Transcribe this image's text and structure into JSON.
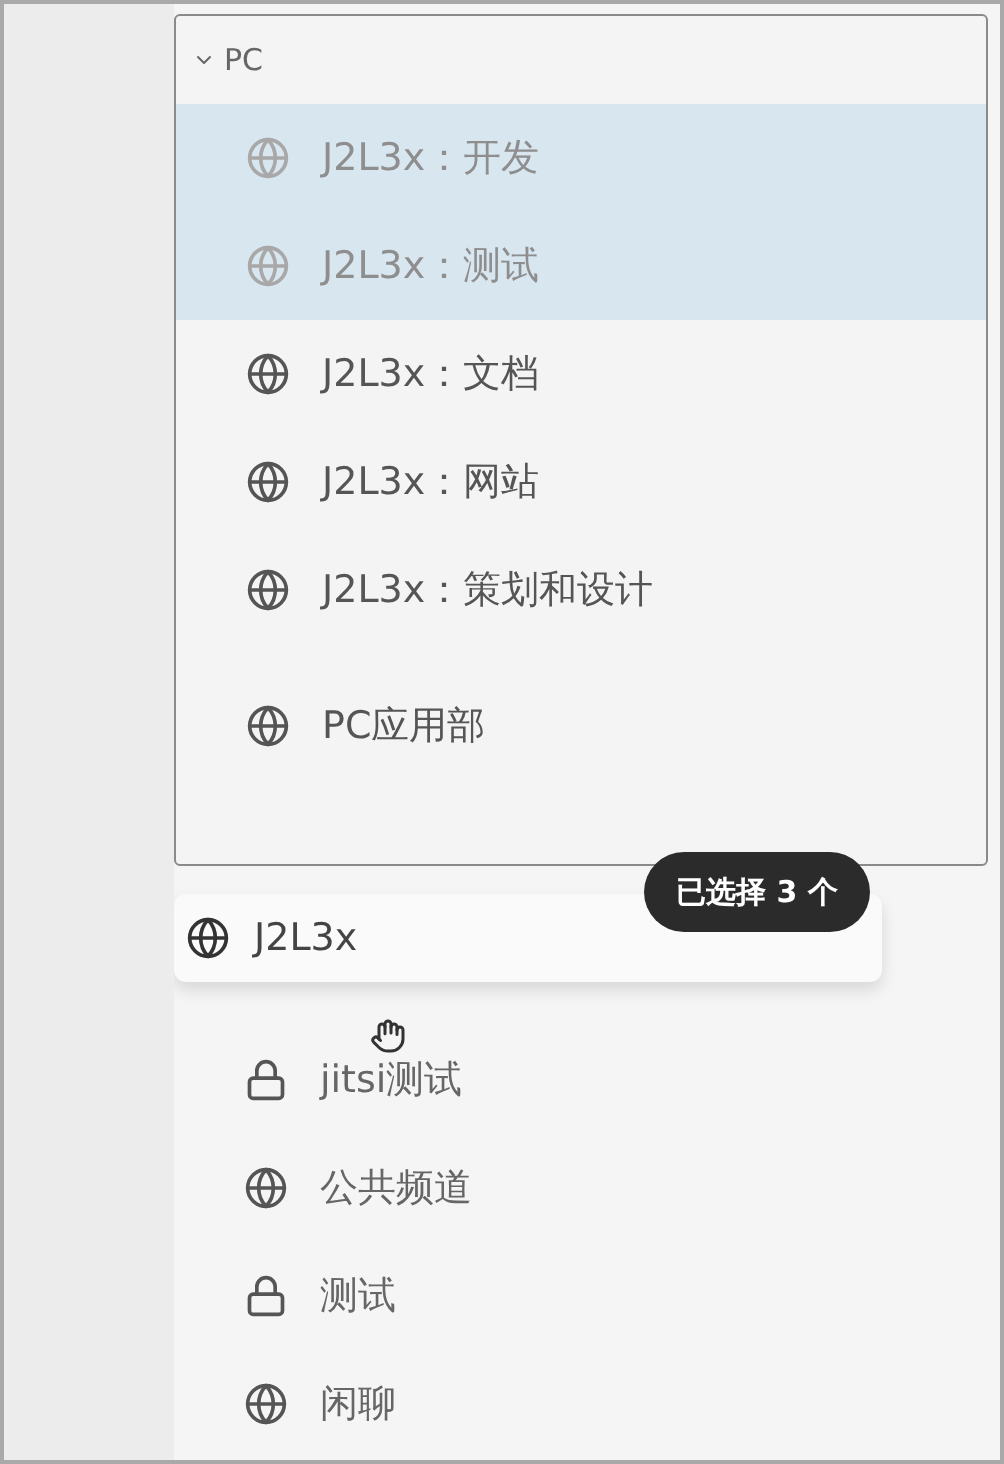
{
  "dropdown": {
    "section": {
      "label": "PC",
      "expanded": true
    },
    "items": [
      {
        "label": "J2L3x：开发",
        "kind": "globe",
        "selected": true
      },
      {
        "label": "J2L3x：测试",
        "kind": "globe",
        "selected": true
      },
      {
        "label": "J2L3x：文档",
        "kind": "globe",
        "selected": false
      },
      {
        "label": "J2L3x：网站",
        "kind": "globe",
        "selected": false
      },
      {
        "label": "J2L3x：策划和设计",
        "kind": "globe",
        "selected": false
      },
      {
        "label": "PC应用部",
        "kind": "globe",
        "selected": false
      }
    ]
  },
  "drag_item": {
    "label": "J2L3x",
    "kind": "globe"
  },
  "badge": "已选择 3 个",
  "channels": [
    {
      "label": "jitsi测试",
      "kind": "lock"
    },
    {
      "label": "公共频道",
      "kind": "globe"
    },
    {
      "label": "测试",
      "kind": "lock"
    },
    {
      "label": "闲聊",
      "kind": "globe"
    }
  ]
}
